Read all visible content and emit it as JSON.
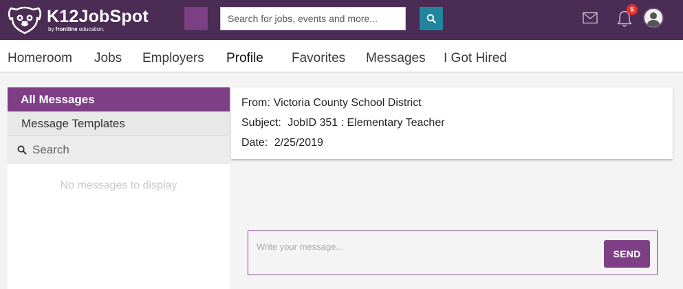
{
  "brand": {
    "name": "K12JobSpot",
    "tagline_prefix": "by ",
    "tagline_brand": "frontline",
    "tagline_suffix": " education."
  },
  "header": {
    "search_placeholder": "Search for jobs, events and more...",
    "notification_count": "5",
    "accent_color": "#4b2c54"
  },
  "nav": {
    "items": [
      {
        "label": "Homeroom"
      },
      {
        "label": "Jobs"
      },
      {
        "label": "Employers"
      },
      {
        "label": "Profile"
      },
      {
        "label": "Favorites"
      },
      {
        "label": "Messages"
      },
      {
        "label": "I Got Hired"
      }
    ]
  },
  "sidebar": {
    "active_label": "All Messages",
    "templates_label": "Message Templates",
    "search_placeholder": "Search",
    "empty_text": "No messages to display"
  },
  "message": {
    "from_label": "From:",
    "from_value": "Victoria County School District",
    "subject_label": "Subject:",
    "subject_value": "JobID 351 : Elementary Teacher",
    "date_label": "Date:",
    "date_value": "2/25/2019"
  },
  "compose": {
    "placeholder": "Write your message...",
    "send_label": "SEND"
  }
}
